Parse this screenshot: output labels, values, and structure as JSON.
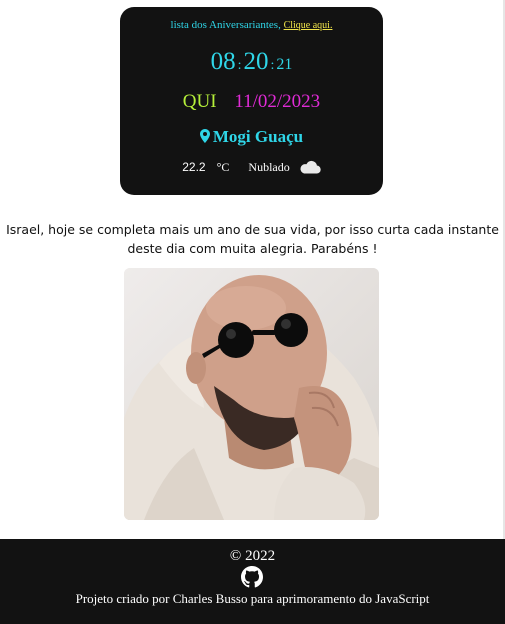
{
  "header": {
    "prefix": "lista dos Aniversariantes,",
    "link_label": "Clique aqui."
  },
  "clock": {
    "hours": "08",
    "minutes": "20",
    "seconds": "21",
    "separator": ":"
  },
  "date": {
    "weekday": "QUI",
    "date": "11/02/2023"
  },
  "location": {
    "city": "Mogi Guaçu",
    "icon": "map-pin-icon"
  },
  "weather": {
    "temperature": "22.2",
    "unit": "°C",
    "condition": "Nublado",
    "icon": "cloud-icon"
  },
  "message": {
    "line1": "Israel, hoje se completa mais um ano de sua vida, por isso curta cada instante",
    "line2": "deste dia com muita alegria. Parabéns !"
  },
  "footer": {
    "copyright": "© 2022",
    "credits": "Projeto criado por Charles Busso para aprimoramento do JavaScript",
    "icon": "github-icon"
  },
  "colors": {
    "card_bg": "#121212",
    "cyan": "#2fd6e8",
    "yellow_link": "#f2e64a",
    "weekday_green": "#b6f03a",
    "date_magenta": "#e02bd6",
    "footer_bg": "#121212"
  }
}
